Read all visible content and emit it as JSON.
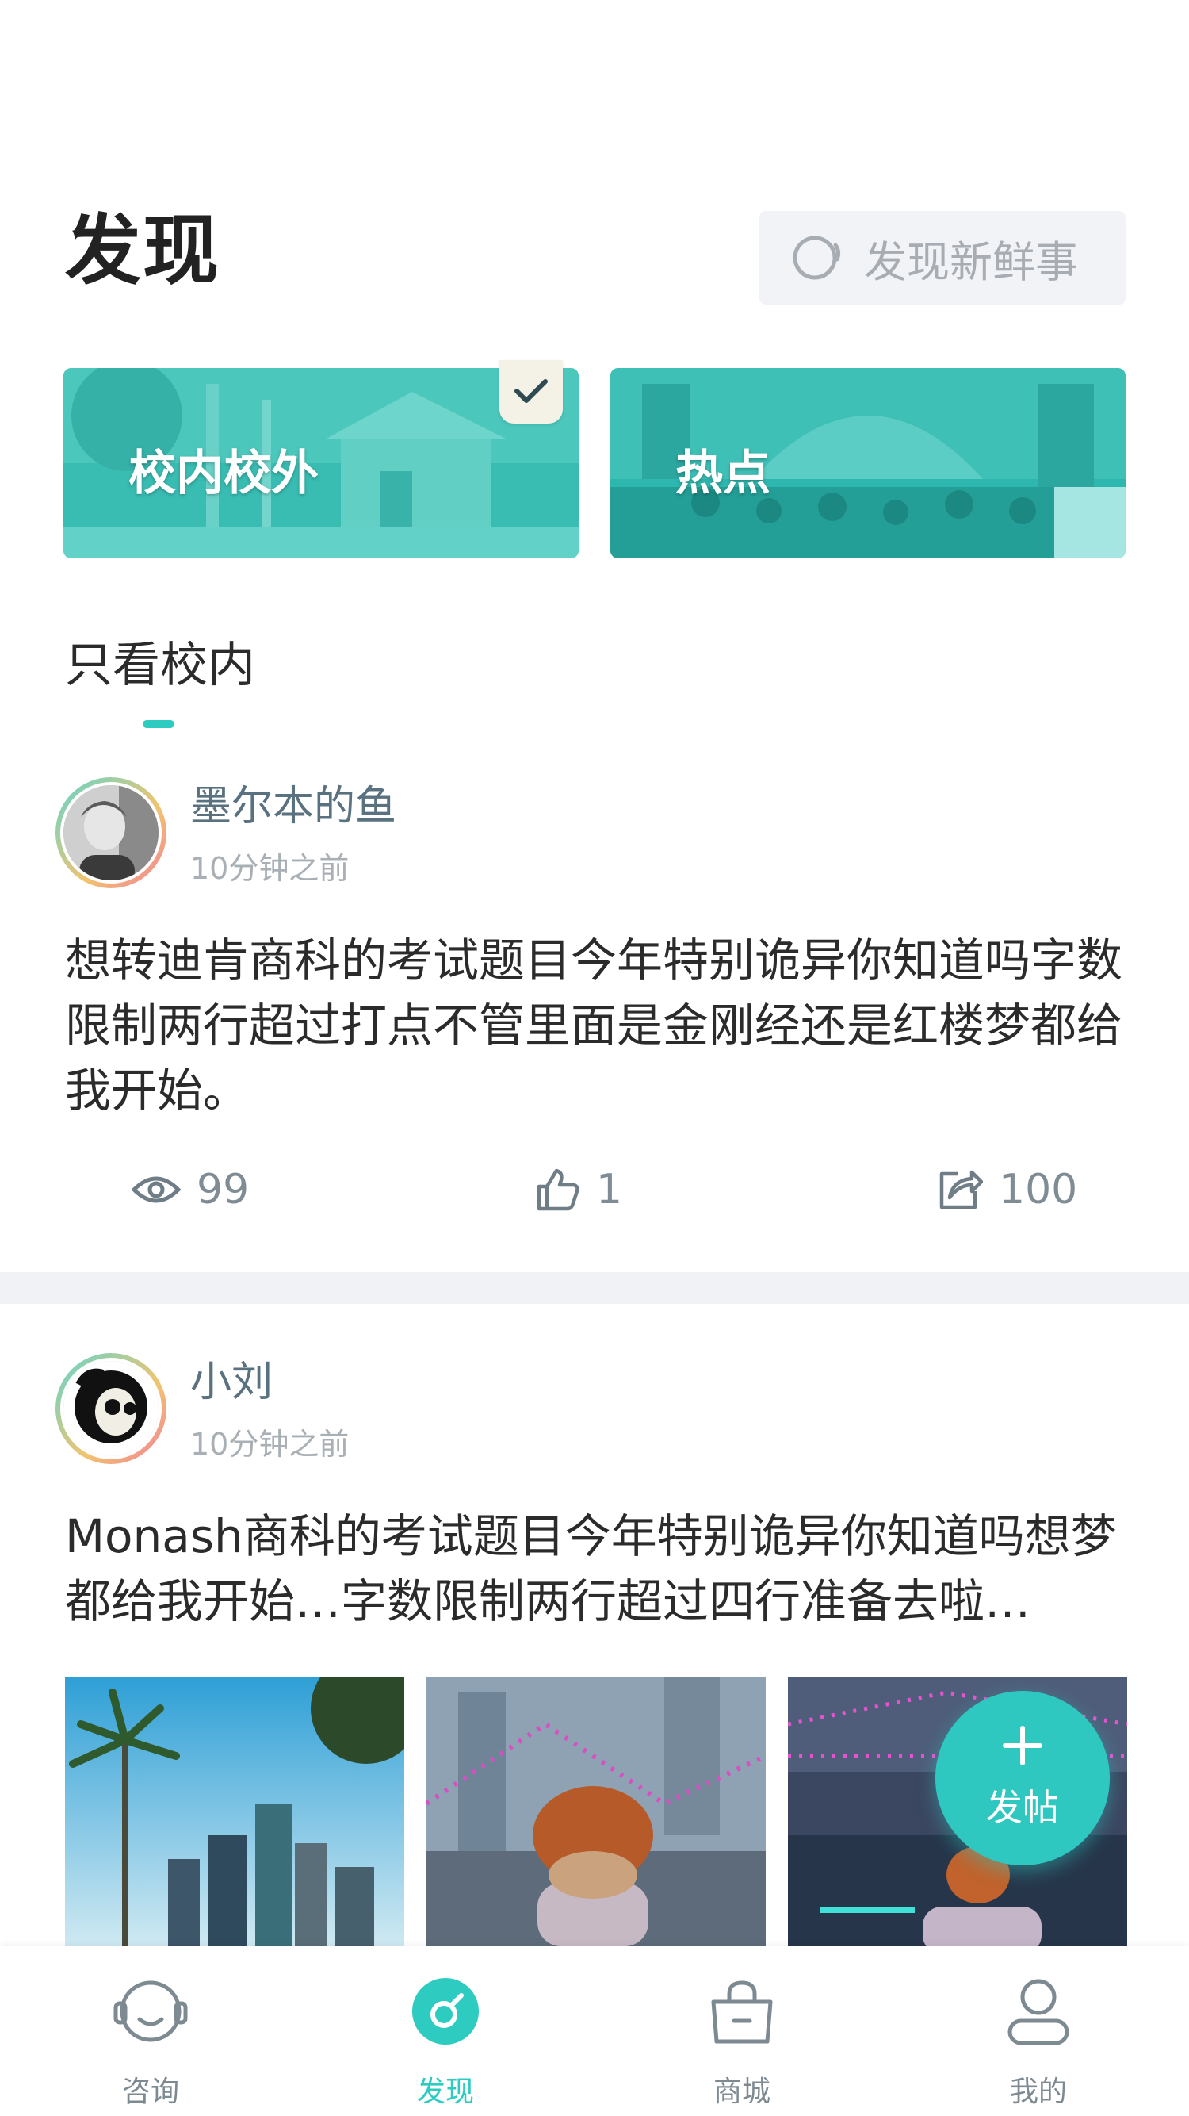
{
  "header": {
    "title": "发现",
    "search_placeholder": "发现新鲜事"
  },
  "categories": [
    {
      "label": "校内校外",
      "selected": true
    },
    {
      "label": "热点",
      "selected": false
    }
  ],
  "filter": {
    "label": "只看校内"
  },
  "posts": [
    {
      "username": "墨尔本的鱼",
      "time": "10分钟之前",
      "content": "想转迪肯商科的考试题目今年特别诡异你知道吗字数限制两行超过打点不管里面是金刚经还是红楼梦都给我开始。",
      "views": "99",
      "likes": "1",
      "shares": "100"
    },
    {
      "username": "小刘",
      "time": "10分钟之前",
      "content": "Monash商科的考试题目今年特别诡异你知道吗想梦都给我开始…字数限制两行超过四行准备去啦…"
    }
  ],
  "fab": {
    "label": "发帖"
  },
  "tabbar": [
    {
      "label": "咨询",
      "icon": "consult-icon",
      "active": false
    },
    {
      "label": "发现",
      "icon": "discover-icon",
      "active": true
    },
    {
      "label": "商城",
      "icon": "shop-icon",
      "active": false
    },
    {
      "label": "我的",
      "icon": "profile-icon",
      "active": false
    }
  ],
  "colors": {
    "accent": "#2ecbc1",
    "username": "#5a7280",
    "muted": "#a8b0b6",
    "divider": "#f0f2f5"
  }
}
